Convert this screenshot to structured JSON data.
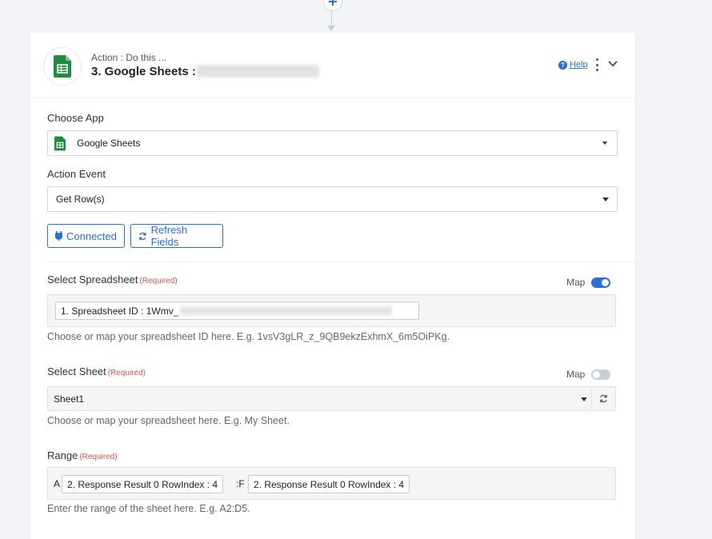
{
  "step": {
    "subtitle": "Action : Do this ...",
    "title": "3. Google Sheets :",
    "help_label": "Help"
  },
  "choose_app": {
    "label": "Choose App",
    "value": "Google Sheets"
  },
  "action_event": {
    "label": "Action Event",
    "value": "Get Row(s)"
  },
  "buttons": {
    "connected": "Connected",
    "refresh": "Refresh Fields"
  },
  "spreadsheet": {
    "label": "Select Spreadsheet",
    "required": "(Required)",
    "map_label": "Map",
    "map_on": true,
    "chip": "1. Spreadsheet ID : 1Wmv_",
    "hint": "Choose or map your spreadsheet ID here. E.g. 1vsV3gLR_z_9QB9ekzExhmX_6m5OiPKg."
  },
  "sheet": {
    "label": "Select Sheet",
    "required": "(Required)",
    "map_label": "Map",
    "map_on": false,
    "value": "Sheet1",
    "hint": "Choose or map your spreadsheet here. E.g. My Sheet."
  },
  "range": {
    "label": "Range",
    "required": "(Required)",
    "prefix": "A",
    "chip1": "2. Response Result 0 RowIndex : 4",
    "separator": ":F",
    "chip2": "2. Response Result 0 RowIndex : 4",
    "hint": "Enter the range of the sheet here. E.g. A2:D5."
  },
  "colors": {
    "accent": "#2a6fd6",
    "sheets_green": "#1e8e3e",
    "required_red": "#d9534f"
  }
}
